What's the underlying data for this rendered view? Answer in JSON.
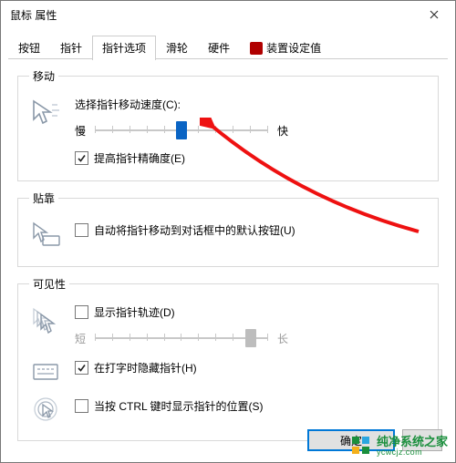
{
  "window": {
    "title": "鼠标 属性"
  },
  "tabs": {
    "items": [
      {
        "label": "按钮"
      },
      {
        "label": "指针"
      },
      {
        "label": "指针选项"
      },
      {
        "label": "滑轮"
      },
      {
        "label": "硬件"
      },
      {
        "label": "装置设定值"
      }
    ],
    "active_index": 2
  },
  "groups": {
    "motion": {
      "legend": "移动",
      "speed_label": "选择指针移动速度(C):",
      "slow": "慢",
      "fast": "快",
      "enhance_precision": "提高指针精确度(E)",
      "enhance_checked": true,
      "speed_value": 5,
      "speed_ticks": 11
    },
    "snap": {
      "legend": "贴靠",
      "snap_label": "自动将指针移动到对话框中的默认按钮(U)",
      "snap_checked": false
    },
    "visibility": {
      "legend": "可见性",
      "trails_label": "显示指针轨迹(D)",
      "trails_checked": false,
      "short": "短",
      "long": "长",
      "trails_value": 9,
      "trails_ticks": 11,
      "hide_typing_label": "在打字时隐藏指针(H)",
      "hide_typing_checked": true,
      "ctrl_locate_label": "当按 CTRL 键时显示指针的位置(S)",
      "ctrl_locate_checked": false
    }
  },
  "buttons": {
    "ok": "确定"
  },
  "watermark": {
    "text": "纯净系统之家",
    "url": "ycwcjz.com"
  }
}
